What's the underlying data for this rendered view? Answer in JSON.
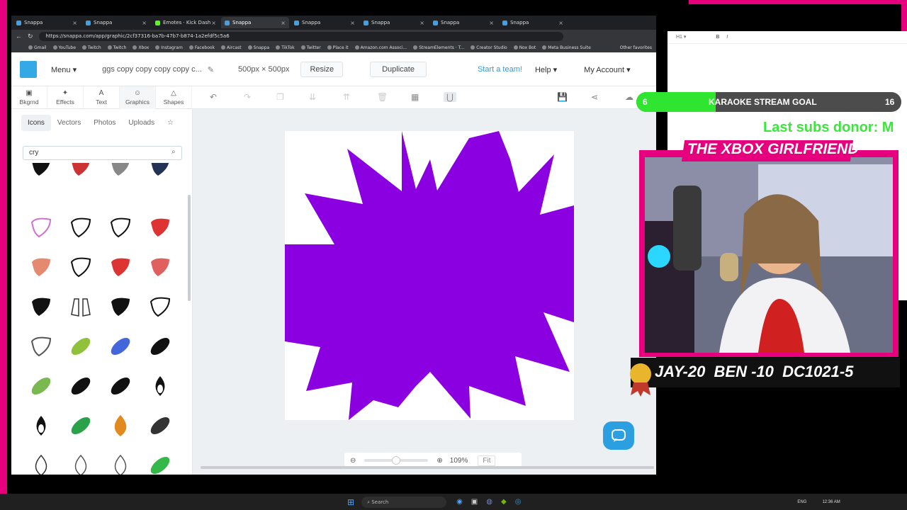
{
  "browser": {
    "tabs": [
      {
        "label": "Snappa",
        "active": false
      },
      {
        "label": "Snappa",
        "active": false
      },
      {
        "label": "Emotes · Kick Dashboard",
        "active": false
      },
      {
        "label": "Snappa",
        "active": true
      },
      {
        "label": "Snappa",
        "active": false
      },
      {
        "label": "Snappa",
        "active": false
      },
      {
        "label": "Snappa",
        "active": false
      },
      {
        "label": "Snappa",
        "active": false
      }
    ],
    "url": "https://snappa.com/app/graphic/2cf37316-ba7b-47b7-b874-1a2efdf5c5a6",
    "bookmarks": [
      "Gmail",
      "YouTube",
      "Twitch",
      "Twitch",
      "Xbox",
      "Instagram",
      "Facebook",
      "Aircast",
      "Snappa",
      "TikTok",
      "Twitter",
      "Place it",
      "Amazon.com Associ...",
      "StreamElements · T...",
      "Creator Studio",
      "Nox Bot",
      "Meta Business Suite"
    ],
    "other_favorites": "Other favorites"
  },
  "header": {
    "menu": "Menu",
    "doc_title": "ggs copy copy copy copy c...",
    "dimensions": "500px × 500px",
    "resize": "Resize",
    "duplicate": "Duplicate",
    "start_team": "Start a team!",
    "help": "Help",
    "account": "My Account"
  },
  "tools": [
    {
      "label": "Bkgrnd",
      "icon": "image-icon"
    },
    {
      "label": "Effects",
      "icon": "wand-icon"
    },
    {
      "label": "Text",
      "icon": "text-icon"
    },
    {
      "label": "Graphics",
      "icon": "smile-icon",
      "active": true
    },
    {
      "label": "Shapes",
      "icon": "triangle-icon"
    }
  ],
  "subtabs": [
    "Icons",
    "Vectors",
    "Photos",
    "Uploads"
  ],
  "search": {
    "value": "cry"
  },
  "zoom": {
    "value": "109%",
    "fit": "Fit",
    "level": 0.5
  },
  "canvas": {
    "shape_color": "#8b00e0",
    "bg": "#ffffff"
  },
  "overlay": {
    "goal_start": "6",
    "goal_text": "KARAOKE STREAM GOAL",
    "goal_end": "16",
    "goal_progress": 0.3,
    "last_subs": "Last subs donor: M",
    "webcam_title": "THE XBOX GIRLFRIEND",
    "leaderboard": "JAY-20  BEN -10  DC1021-5"
  },
  "taskbar": {
    "search": "Search",
    "time": "12:36 AM",
    "lang": "ENG"
  }
}
